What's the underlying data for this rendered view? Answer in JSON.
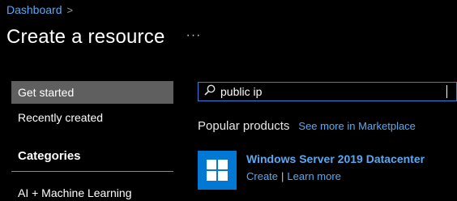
{
  "breadcrumb": {
    "items": [
      "Dashboard"
    ],
    "separator": ">"
  },
  "header": {
    "title": "Create a resource",
    "more_label": "···"
  },
  "nav": {
    "items": [
      {
        "label": "Get started",
        "active": true
      },
      {
        "label": "Recently created",
        "active": false
      }
    ],
    "categories_heading": "Categories",
    "categories": [
      "AI + Machine Learning"
    ]
  },
  "search": {
    "value": "public ip",
    "icon": "search-icon"
  },
  "popular": {
    "heading": "Popular products",
    "see_more": "See more in Marketplace",
    "products": [
      {
        "name": "Windows Server 2019 Datacenter",
        "create_label": "Create",
        "separator": "|",
        "learn_label": "Learn more",
        "icon": "windows-icon"
      }
    ]
  },
  "colors": {
    "accent": "#0078d4",
    "link": "#5aa9f0",
    "background": "#000000",
    "nav_active": "#5f5f5f"
  }
}
